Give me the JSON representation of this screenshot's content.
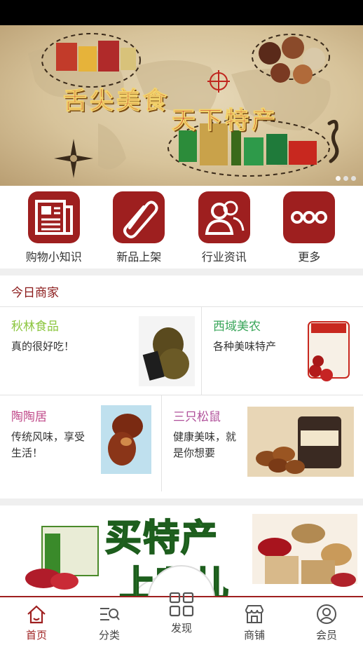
{
  "banner": {
    "title_line1": "舌尖美食",
    "title_line2": "天下特产",
    "pages": 3,
    "active_page": 1
  },
  "quick_nav": [
    {
      "label": "购物小知识",
      "icon": "newspaper-icon"
    },
    {
      "label": "新品上架",
      "icon": "paperclip-icon"
    },
    {
      "label": "行业资讯",
      "icon": "users-icon"
    },
    {
      "label": "更多",
      "icon": "more-dots-icon"
    }
  ],
  "today_shops": {
    "title": "今日商家",
    "shops": [
      {
        "name": "秋林食品",
        "desc": "真的很好吃！",
        "name_color": "#8cc63f"
      },
      {
        "name": "西域美农",
        "desc": "各种美味特产",
        "name_color": "#3aa65a"
      },
      {
        "name": "陶陶居",
        "desc": "传统风味，享受生活！",
        "name_color": "#c04a8a"
      },
      {
        "name": "三只松鼠",
        "desc": "健康美味，就是你想要",
        "name_color": "#b0509a"
      }
    ]
  },
  "promo": {
    "text_line1": "买特产",
    "text_line2": "上哪儿"
  },
  "tabbar": {
    "items": [
      {
        "label": "首页",
        "icon": "home-icon",
        "active": true
      },
      {
        "label": "分类",
        "icon": "category-search-icon",
        "active": false
      },
      {
        "label": "发现",
        "icon": "grid-icon",
        "active": false
      },
      {
        "label": "商铺",
        "icon": "shop-icon",
        "active": false
      },
      {
        "label": "会员",
        "icon": "user-icon",
        "active": false
      }
    ]
  },
  "colors": {
    "brand": "#9e1f1f",
    "divider": "#efefef"
  }
}
